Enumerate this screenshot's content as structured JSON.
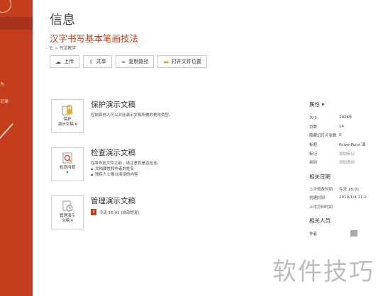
{
  "backstage": {
    "page_title": "信息",
    "document_title": "汉字书写基本笔画技法",
    "document_path": "E: » 书法教学",
    "actions": [
      {
        "label": "上传",
        "icon": "cloud-upload-icon"
      },
      {
        "label": "共享",
        "icon": "share-icon"
      },
      {
        "label": "复制路径",
        "icon": "link-icon"
      },
      {
        "label": "打开文件位置",
        "icon": "folder-icon"
      }
    ]
  },
  "sidebar": {
    "fragment_1": "为",
    "fragment_2": "记录"
  },
  "protect": {
    "tile_label_1": "保护",
    "tile_label_2": "演示文稿",
    "title": "保护演示文稿",
    "desc": "控制其他人可以对此演示文稿所做的更改类型。"
  },
  "inspect": {
    "tile_label_1": "检查问题",
    "title": "检查演示文稿",
    "desc": "在发布此文件之前，请注意其是否包含:",
    "bullets": [
      "文档属性和作者的姓名",
      "残疾人士难以阅读的内容"
    ]
  },
  "manage": {
    "tile_label_1": "管理演示",
    "tile_label_2": "文稿",
    "title": "管理演示文稿",
    "version": "今天 16:01 (自动恢复)"
  },
  "properties": {
    "header": "属性",
    "rows": [
      {
        "k": "大小",
        "v": "192KB"
      },
      {
        "k": "页数",
        "v": "14"
      },
      {
        "k": "隐藏幻灯片张数",
        "v": "0"
      },
      {
        "k": "标题",
        "v": "PowerPoint 演"
      },
      {
        "k": "标记",
        "v": "添加标记"
      },
      {
        "k": "类别",
        "v": "添加类别"
      }
    ],
    "dates_header": "相关日期",
    "dates": [
      {
        "k": "上次修改时间",
        "v": "今天 16:01"
      },
      {
        "k": "创建时间",
        "v": "2019/1/4 11:2"
      },
      {
        "k": "上次打印时间",
        "v": ""
      }
    ],
    "people_header": "相关人员",
    "author_label": "作者"
  },
  "watermark": "软件技巧",
  "colors": {
    "accent": "#c43e1c",
    "accent_dark": "#a5321a"
  }
}
